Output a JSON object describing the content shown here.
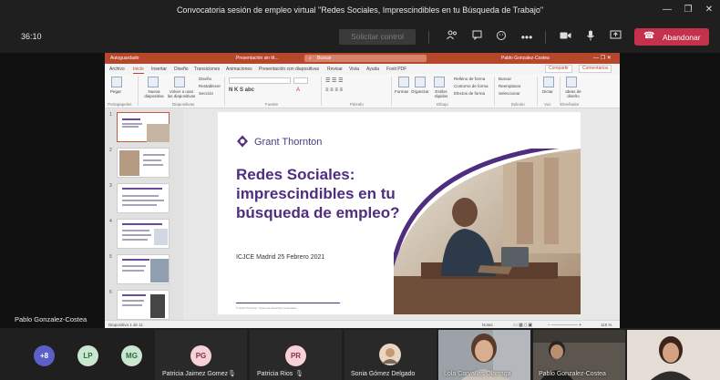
{
  "window": {
    "title": "Convocatoria sesión de empleo virtual \"Redes Sociales, Imprescindibles en tu Búsqueda de Trabajo\"",
    "minimize": "—",
    "maximize": "❐",
    "close": "✕"
  },
  "meeting": {
    "timer": "36:10",
    "raise_label": "Solicitar control",
    "leave_label": "Abandonar",
    "presenter_name": "Pablo Gonzalez-Costea"
  },
  "ppt": {
    "autosave": "Autoguardado",
    "filename": "Presentación sin tít...",
    "search_placeholder": "Buscar",
    "user": "Pablo Gonzalez-Costea",
    "tabs": [
      "Archivo",
      "Inicio",
      "Insertar",
      "Diseño",
      "Transiciones",
      "Animaciones",
      "Presentación con diapositivas",
      "Revisar",
      "Vista",
      "Ayuda",
      "Foxit PDF"
    ],
    "share": "Compartir",
    "comments": "Comentarios",
    "ribbon": {
      "paste": "Pegar",
      "new_slide": "Nueva diapositiva",
      "reuse": "Volver a usar las diapositivas",
      "design": "Diseño",
      "reset": "Restablecer",
      "section": "Sección",
      "shapes": "Formas",
      "arrange": "Organizar",
      "quick_styles": "Estilos rápidos",
      "fill": "Relleno de forma",
      "outline": "Contorno de forma",
      "effects": "Efectos de forma",
      "find": "Buscar",
      "replace": "Reemplazar",
      "select": "Seleccionar",
      "dictate": "Dictar",
      "ideas": "Ideas de diseño",
      "groups": [
        "Portapapeles",
        "Diapositivas",
        "Fuente",
        "Párrafo",
        "Dibujo",
        "Edición",
        "Voz",
        "Diseñador"
      ]
    },
    "thumbs": [
      "1",
      "2",
      "3",
      "4",
      "5",
      "6"
    ],
    "status": {
      "slide": "Diapositiva 1 de 11",
      "notes": "Notas",
      "zoom": "115 %"
    }
  },
  "slide": {
    "brand": "Grant Thornton",
    "headline_1": "Redes Sociales:",
    "headline_2": "imprescindibles en tu",
    "headline_3": "búsqueda de empleo?",
    "subtitle": "ICJCE Madrid 25 Febrero 2021",
    "footer": "© Grant Thornton. Todos los derechos reservados."
  },
  "participants": [
    {
      "initials": "+8",
      "color": "#5b5fc7",
      "text_color": "#ffffff"
    },
    {
      "initials": "LP",
      "color": "#c9e7d0",
      "text_color": "#2f6b3f"
    },
    {
      "initials": "MG",
      "color": "#c9e7d0",
      "text_color": "#2f6b3f"
    },
    {
      "initials": "PG",
      "name": "Patricia Jaimez Gomez",
      "color": "#f6d1d7",
      "text_color": "#8a2f43"
    },
    {
      "initials": "PR",
      "name": "Patricia Rios",
      "color": "#f6d1d7",
      "text_color": "#8a2f43"
    },
    {
      "name": "Sonia Gómez Delgado"
    },
    {
      "name": "Lola Carvallas Olarraga"
    },
    {
      "name": "Pablo Gonzalez-Costea"
    },
    {
      "name": ""
    }
  ],
  "colors": {
    "leave": "#c4314b",
    "ppt_accent": "#b7472a",
    "brand_purple": "#4f2d7f"
  }
}
